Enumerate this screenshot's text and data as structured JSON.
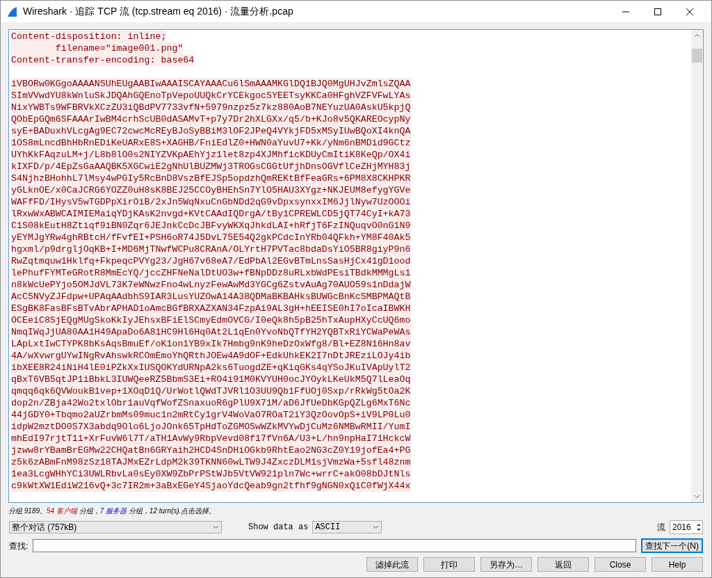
{
  "window": {
    "title": "Wireshark · 追踪 TCP 流 (tcp.stream eq 2016) · 流量分析.pcap"
  },
  "stream": {
    "kind": "client",
    "header_lines": [
      "Content-disposition: inline;",
      "        filename=\"image001.png\"",
      "Content-transfer-encoding: base64"
    ],
    "body_lines": [
      "iVBORw0KGgoAAAANSUhEUgAABIwAAAISCAYAAACu6lSmAAAMKGlDQ1BJQ0MgUHJvZmlsZQAA",
      "SImVVwdYU8kWnluSkJDQAhGQEnoTpVepoUUQkCrYCEkgocSYEETsyKKCa0HFghVZFVFwLYAs",
      "NixYWBTs9WFBRVkXCzZU3iQBdPV7733vfN+5979nzpz5z7kz880AoB7NEYuzUA0AskU5kpjQ",
      "QObEpGQm6SFAAArIwBM4crhScUB0dASAMvT+p7y7Dr2hXLGXx/q5/b+KJo8v5QKAREOcypNy",
      "syE+BADuxhVLcgAg9EC72cwcMcREyBJoSyBBiM3lOF2JPeQ4VYkjFD5xMSyIUwBQoXI4knQA",
      "1OS8mLncdBhHbRnEDiKeUARxE8S+XAGHB/FniEdlZ0+HWN0aYuvU7+Kk/yNm6nBMDid9GCtz",
      "UYhKkFAqzuLM+j/L8b8lO0s2NIYZVKpAEhYjz1let8zp4XJMhficKDUyCmItiK8KeQp/OX4i",
      "kIXFD/p/4EpZsGaAAQBK5XGCwiE2gNhUlBUZMWj3TROGsCGGtUfjhDnsOGVflCeZHjMYH83j",
      "S4NjhzBHohhL7lMsy4wPGIy5RcBnD8VszBfEJSp5opdzhQmREKtBfFeaGRs+6PM8X8CKHPKR",
      "yGLknOE/x0CaJCRG6YOZZ0uH8sK8BEJ25CCOyBHEhSn7YlO5HAU3XYgz+NKJEUM8efygYGVe",
      "WAFfFD/IHysV5wTGDPpXirOiB/2xJn5WqNxuCnGbNDd2qG9vDpxsynxxIM6JjlNyw7UzOOOi",
      "lRxwWxABWCAIMIEMaiqYDjKAsK2nvgd+KVtCAAdIQDrgA/tBy1CPREWLCD5jQT74CyI+kA73",
      "C1S08kEutH8Ztiqf9iBN0Zqr6JEJnkCcDcJBFvyWKXqJhkdLAI+hRfjT6FzINQuqvO0nG1N9",
      "yEYMJgYRw4ghRBtcH/fFvfEI+PSH6oR74J5DvL75E54Q2gkPCdcInYRb04QFkh+YM8F40Ak5",
      "hgxml/p9drgljOqKB+I+MD6MjTNwfWCPu8CRAnA/OLYrtH7PVTac8bdaDsYiO5BR8giyP9n6",
      "RwZqtmquw1Hklfq+FkpeqcPVYg23/JgH67v68eA7/EdPbAl2EGvBTmLnsSasHjCx41gD1ood",
      "lePhufFYMTeGRotR8MmEcYQ/jccZHFNeNalDtUO3w+fBNpDDz8uRLxbWdPEsiTBdkMMMgLs1",
      "n8kWcUePYjo5OMJdVL73K7eWNwzFno4wLnyzFewAwMd3YGCg6ZstvAuAg70AUO59s1nDdajW",
      "AcC5NVyZJFdpw+UPAqAAdbhS9IAR3LusYUZOwA14A38QDMaBKBAHksBUWGcBnKcSMBPMAQtB",
      "ESgBK8FasBFsBTvAbrAPHAD1oAmcBGfBRXAZXAN34FzpAi9AL3gH+hEEISE0hI7oIcaIBWKH",
      "OCEeiC8SjEQgMUgSkoKkIyJEhsxBFiElSCmyEdmOVCG/I0eQk8h5pB25hTxAupHXyCcUQ6mo",
      "NmqIWqJjUA80AA1H49ApaDo6A81HC9Hl6Hq0At2L1qEn0YvoNbQTfYH2YQBTxRiYCWaPeWAs",
      "LApLxtIwCTYPK8bKsAqsBmuEf/oK1on1YB9xIk7Hmbg9nK9heDzOxWfg8/Bl+EZ8N16Hn8av",
      "4A/wXvwrgUYwINgRvAhswkRCOmEmoYhQRthJOEw4A9dOF+EdkUhkEK2I7nDtJREziLOJy4ib",
      "ibXEE8R24iNiH4lE0iPZkXxIUSQOKYdURNpA2ks6TuogdZE+qKiqGKs4qYSoJKuIVApUylT2",
      "qBxT6VB5qtJP1iBbkL3IUWQeeRZ5BbmS3Ei+RO4i91M0KVYUH0ocJYOykLKeUkM5Q7lLeaOq",
      "qmqq6qk6QVWoukB1vep+1XOqD1Q/UrWotlQWdTJVRl1O3UU9Qb1FfUOj0Sxp/rRkWg5tOa2K",
      "dop2n/ZBja42Wo2txlObr1auVqfWofZSnaxuoR6gPlU9X71M/aD6JfUeDbKGpQZLg6MxT6Nc",
      "44jGDY0+Tbqmo2aUZrbmMs09muc1n2mRtCy1grV4WoVaO7ROaT2iY3QzOovOpS+iV9LP0Lu0",
      "idpW2mztDO0S7X3abdq9Olo6LjoJOnk65TpHdToZGMOSwWZkMVYwDjCuMz6NMBwRMII/YumI",
      "mhEdI97rjtT11+XrFuvW6l7T/aTH1AvWy9RbpVevd08f17fVn6A/U3+L/hn9npHaI71HckcW",
      "jzww8rYBamBrEGMw22CHQatBn6GRYaih2HCD4SnDHiOGkb9RhtEao2NG3cZ0Y19jofEa4+PG",
      "z5k6zABmFnM98zSz18TAJMxEZrLdpM2k39TKNN60wLTW9J4ZxczDLM1sjVmzWa+5sfl48znm",
      "1ea3LcgWHhYCi3UWLRbvLa0sEy0XW9ZbPrPStWJb5VtVW921pln7Wc+wrrC+akO08bDJtNls",
      "c9kWtXW1EdiW216vQ+3c7IR2m+3aBxEGeY4SjaoYdcQeab9gn2tfhf9gNGN0xQiC0fWjX44x"
    ]
  },
  "status": [
    {
      "kind": "plain",
      "text": "分组 9189。"
    },
    {
      "kind": "client",
      "text": "54 客户端"
    },
    {
      "kind": "plain",
      "text": " 分组，"
    },
    {
      "kind": "server",
      "text": "7 服务器"
    },
    {
      "kind": "plain",
      "text": " 分组，12 turn(s).点击选择。"
    }
  ],
  "conversation_select": {
    "value": "整个对话 (757kB)"
  },
  "show_data_as": {
    "label": "Show data as",
    "value": "ASCII"
  },
  "stream_number": {
    "label": "流",
    "value": "2016"
  },
  "find": {
    "label": "查找:",
    "button": "查找下一个(N)"
  },
  "buttons": [
    "滤掉此流",
    "打印",
    "另存为…",
    "返回",
    "Close",
    "Help"
  ]
}
